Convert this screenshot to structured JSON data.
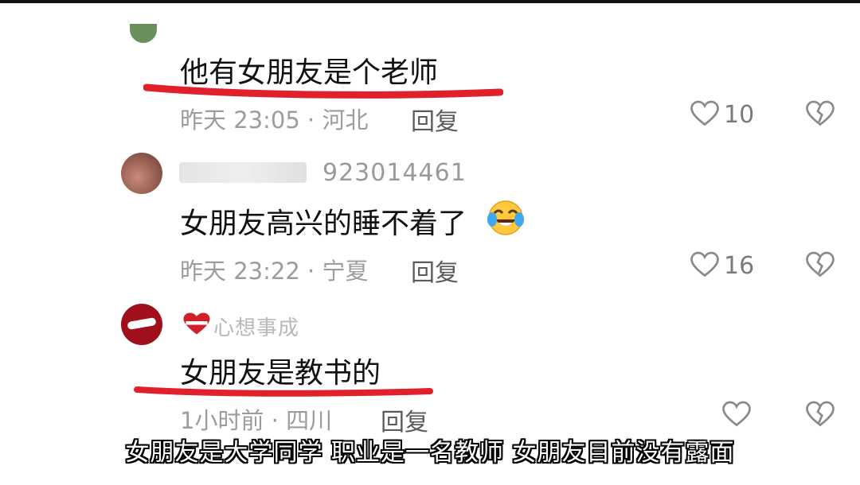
{
  "comments": [
    {
      "text": "他有女朋友是个老师",
      "meta": "昨天 23:05 · 河北",
      "reply_label": "回复",
      "likes": "10",
      "underline_color": "#e0202a"
    },
    {
      "username": "923014461",
      "text": "女朋友高兴的睡不着了",
      "emoji": "laughing-crying-emoji",
      "meta": "昨天 23:22 · 宁夏",
      "reply_label": "回复",
      "likes": "16"
    },
    {
      "username": "心想事成",
      "text": "女朋友是教书的",
      "meta": "1小时前 · 四川",
      "reply_label": "回复",
      "underline_color": "#e0202a"
    }
  ],
  "subtitle": "女朋友是大学同学 职业是一名教师 女朋友目前没有露面",
  "colors": {
    "accent_red": "#e0202a",
    "meta_gray": "#9c9c9c",
    "heart_gray": "#8a8a8a"
  }
}
